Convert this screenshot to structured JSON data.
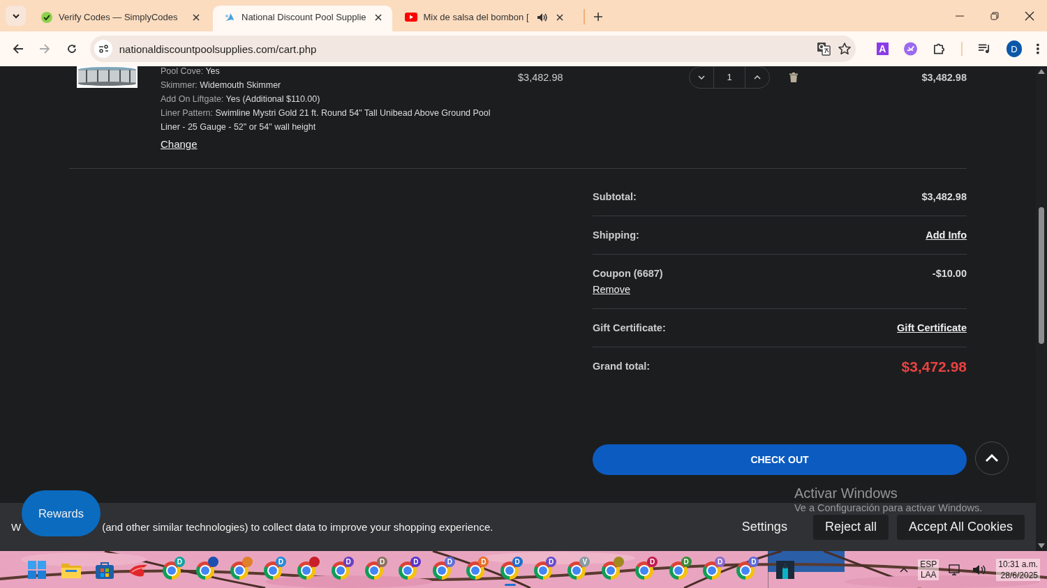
{
  "browser": {
    "tabs": [
      {
        "title": "Verify Codes — SimplyCodes",
        "audio": false,
        "selected": false
      },
      {
        "title": "National Discount Pool Supplie",
        "audio": false,
        "selected": true
      },
      {
        "title": "Mix de salsa del bombon [",
        "audio": true,
        "selected": false
      }
    ],
    "address": "nationaldiscountpoolsupplies.com/cart.php",
    "extension_label": "A",
    "profile_initial": "D"
  },
  "cart_item": {
    "options": [
      {
        "label": "Pool Cove:",
        "value": "Yes"
      },
      {
        "label": "Skimmer:",
        "value": "Widemouth Skimmer"
      },
      {
        "label": "Add On Liftgate:",
        "value": "Yes (Additional $110.00)"
      },
      {
        "label": "Liner Pattern:",
        "value": "Swimline Mystri Gold 21 ft. Round 54\" Tall Unibead Above Ground Pool Liner - 25 Gauge - 52\" or 54\" wall height"
      }
    ],
    "change_link": "Change",
    "price": "$3,482.98",
    "quantity": "1",
    "total": "$3,482.98"
  },
  "summary": {
    "rows": [
      {
        "kind": "plain",
        "label": "Subtotal:",
        "value": "$3,482.98"
      },
      {
        "kind": "link",
        "label": "Shipping:",
        "value": "Add Info"
      },
      {
        "kind": "coupon",
        "label": "Coupon (6687)",
        "action": "Remove",
        "value": "-$10.00"
      },
      {
        "kind": "link",
        "label": "Gift Certificate:",
        "value": "Gift Certificate"
      },
      {
        "kind": "grand",
        "label": "Grand total:",
        "value": "$3,472.98"
      }
    ],
    "checkout": "CHECK OUT"
  },
  "cookie_banner": {
    "text_start": "W",
    "text": "(and other similar technologies) to collect data to improve your shopping experience.",
    "buttons": [
      {
        "label": "Settings",
        "kind": "text"
      },
      {
        "label": "Reject all",
        "kind": "filled"
      },
      {
        "label": "Accept All Cookies",
        "kind": "filled"
      }
    ]
  },
  "rewards_button": "Rewards",
  "activation_notice": {
    "title": "Activar Windows",
    "text": "Ve a Configuración para activar Windows."
  },
  "taskbar": {
    "apps": [
      {
        "kind": "start",
        "selected": false
      },
      {
        "kind": "files",
        "selected": false
      },
      {
        "kind": "store",
        "selected": false
      },
      {
        "kind": "app",
        "selected": false
      },
      {
        "kind": "chrome",
        "badge": "D",
        "color": "#17a2a2",
        "selected": false
      },
      {
        "kind": "chrome",
        "color": "#1b4fb0",
        "selected": false
      },
      {
        "kind": "chrome",
        "color": "#e0802a",
        "selected": false
      },
      {
        "kind": "chrome",
        "badge": "D",
        "color": "#2a8ad8",
        "selected": false
      },
      {
        "kind": "chrome",
        "color": "#c8202a",
        "selected": false
      },
      {
        "kind": "chrome",
        "badge": "D",
        "color": "#6a3fc0",
        "selected": false
      },
      {
        "kind": "chrome",
        "badge": "D",
        "color": "#8c7060",
        "selected": false
      },
      {
        "kind": "chrome",
        "badge": "D",
        "color": "#5a35c8",
        "selected": false
      },
      {
        "kind": "chrome",
        "badge": "D",
        "color": "#5f6fd8",
        "selected": false
      },
      {
        "kind": "chrome",
        "badge": "D",
        "color": "#e8702a",
        "selected": false
      },
      {
        "kind": "chrome",
        "badge": "D",
        "color": "#1f6fd0",
        "selected": true
      },
      {
        "kind": "chrome",
        "badge": "D",
        "color": "#6a4cc8",
        "selected": false
      },
      {
        "kind": "chrome",
        "badge": "V",
        "color": "#8a9aa0",
        "selected": false
      },
      {
        "kind": "chrome",
        "color": "#a08a20",
        "selected": false
      },
      {
        "kind": "chrome",
        "badge": "D",
        "color": "#c01a50",
        "selected": false
      },
      {
        "kind": "chrome",
        "badge": "D",
        "color": "#3a8a3a",
        "selected": false
      },
      {
        "kind": "chrome",
        "badge": "D",
        "color": "#8a6ad0",
        "selected": false
      },
      {
        "kind": "chrome",
        "badge": "D",
        "color": "#5a6ad8",
        "selected": false
      },
      {
        "kind": "game",
        "selected": false
      }
    ],
    "tray": {
      "language": "ESP",
      "layout": "LAA",
      "time": "10:31 a.m.",
      "date": "28/6/2025"
    }
  }
}
